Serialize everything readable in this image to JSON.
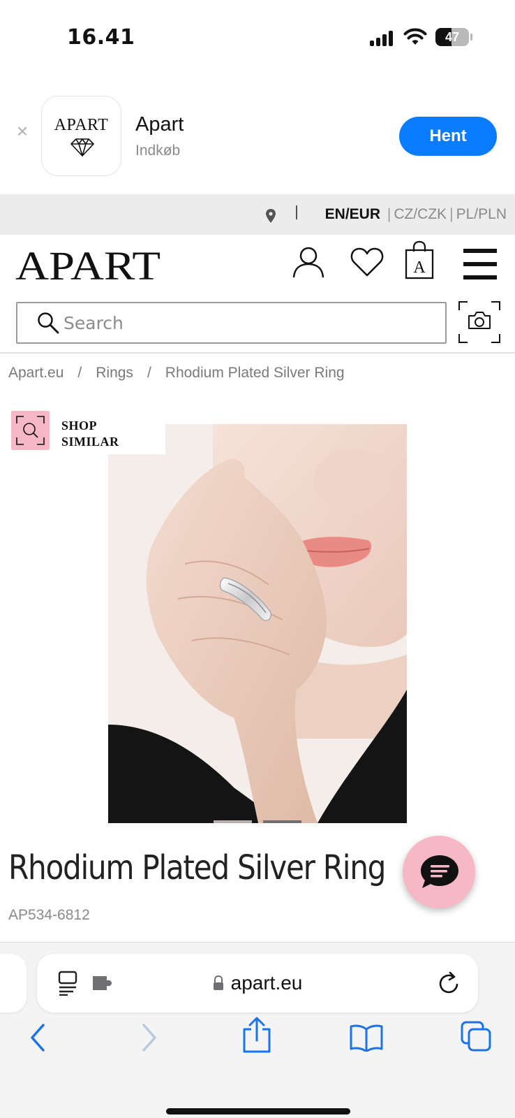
{
  "status_bar": {
    "time": "16.41",
    "battery": "47",
    "battery_level": 0.47
  },
  "app_banner": {
    "icon_text": "APART",
    "app_name": "Apart",
    "app_category": "Indkøb",
    "get_label": "Hent"
  },
  "locale": {
    "active": "EN/EUR",
    "option_cz": "CZ/CZK",
    "option_pl": "PL/PLN",
    "separator": "|"
  },
  "header": {
    "logo_text": "APART",
    "search_placeholder": "Search"
  },
  "breadcrumb": {
    "items": [
      "Apart.eu",
      "Rings",
      "Rhodium Plated Silver Ring"
    ],
    "separator": "/"
  },
  "shop_similar": {
    "line1": "SHOP",
    "line2": "SIMILAR"
  },
  "product": {
    "title": "Rhodium Plated Silver Ring",
    "sku": "AP534-6812"
  },
  "browser": {
    "url": "apart.eu"
  },
  "colors": {
    "brand_pink": "#f6b8c4",
    "ios_blue": "#0a7cff",
    "safari_icon_blue": "#1a73e8"
  }
}
